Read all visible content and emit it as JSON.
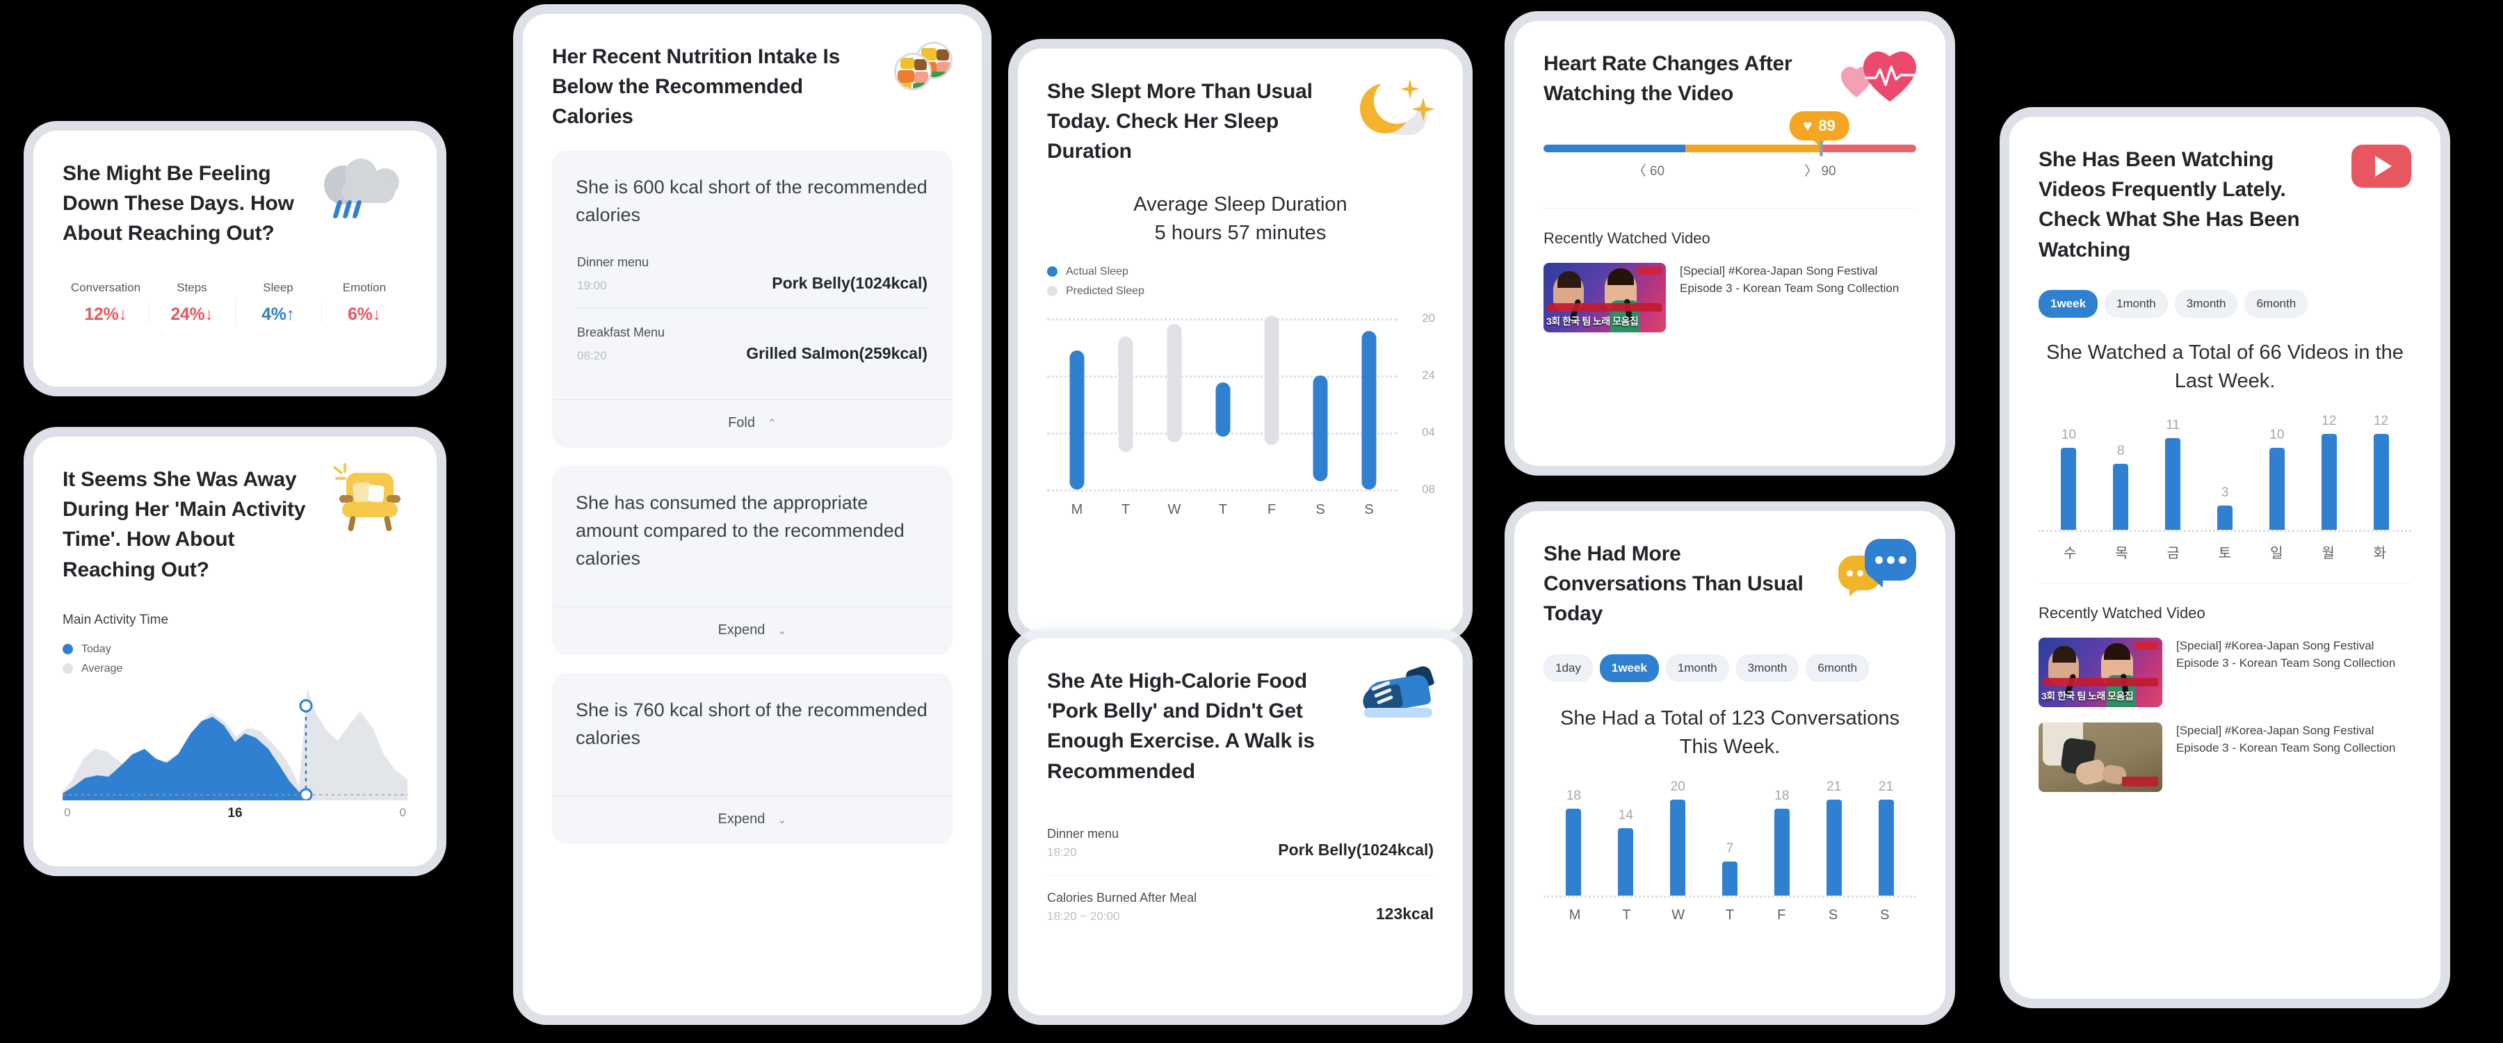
{
  "colors": {
    "blue": "#2f80d0",
    "grey": "#dfe2e7",
    "red": "#e8575f",
    "amber": "#f4a623"
  },
  "mood_card": {
    "headline": "She Might Be Feeling Down These Days. How About Reaching Out?",
    "icon": "rain-cloud-icon",
    "metrics": [
      {
        "label": "Conversation",
        "value": "12%",
        "arrow": "↓",
        "direction": "down"
      },
      {
        "label": "Steps",
        "value": "24%",
        "arrow": "↓",
        "direction": "down"
      },
      {
        "label": "Sleep",
        "value": "4%",
        "arrow": "↑",
        "direction": "up"
      },
      {
        "label": "Emotion",
        "value": "6%",
        "arrow": "↓",
        "direction": "down"
      }
    ]
  },
  "activity_card": {
    "headline": "It Seems She Was Away During Her 'Main Activity Time'. How About Reaching Out?",
    "icon": "armchair-icon",
    "chart_label": "Main Activity Time",
    "legend": [
      {
        "label": "Today",
        "color": "#2f80d0"
      },
      {
        "label": "Average",
        "color": "#dfe2e7"
      }
    ],
    "axis": {
      "left": "0",
      "center": "16",
      "right": "0"
    }
  },
  "nutrition_card": {
    "headline": "Her Recent Nutrition Intake Is Below the Recommended Calories",
    "icon": "food-plates-icon",
    "panels": [
      {
        "text": "She is 600 kcal short of the recommended calories",
        "meals": [
          {
            "label": "Dinner menu",
            "time": "19:00",
            "value": "Pork Belly(1024kcal)"
          },
          {
            "label": "Breakfast Menu",
            "time": "08:20",
            "value": "Grilled Salmon(259kcal)"
          }
        ],
        "foot": "Fold",
        "foot_chevron": "⌃"
      },
      {
        "text": "She has consumed the appropriate amount compared to the recommended calories",
        "meals": [],
        "foot": "Expend",
        "foot_chevron": "⌄"
      },
      {
        "text": "She is 760 kcal short of the recommended calories",
        "meals": [],
        "foot": "Expend",
        "foot_chevron": "⌄"
      }
    ]
  },
  "sleep_card": {
    "headline": "She Slept More Than Usual Today. Check Her Sleep Duration",
    "icon": "moon-stars-icon",
    "center_title": "Average Sleep Duration\n5 hours 57 minutes",
    "legend": [
      {
        "label": "Actual Sleep",
        "color": "#2f80d0"
      },
      {
        "label": "Predicted Sleep",
        "color": "#dfe1e5"
      }
    ],
    "chart_data": {
      "type": "bar",
      "title": "Average Sleep Duration",
      "categories": [
        "M",
        "T",
        "W",
        "T",
        "F",
        "S",
        "S"
      ],
      "ytick_labels": [
        "20",
        "24",
        "04",
        "08"
      ],
      "ylabel": "",
      "xlabel": "",
      "grid": true,
      "note": "Floating bars spanning sleep start to sleep end on a 20:00-08:00 clock axis",
      "series": [
        {
          "name": "Actual Sleep",
          "color": "#2f80d0",
          "bars": [
            {
              "day": "M",
              "start": "22:20",
              "end": "08:00"
            },
            {
              "day": "T",
              "start": null,
              "end": null
            },
            {
              "day": "W",
              "start": null,
              "end": null
            },
            {
              "day": "T",
              "start": "00:30",
              "end": "04:40"
            },
            {
              "day": "F",
              "start": null,
              "end": null
            },
            {
              "day": "S",
              "start": "23:50",
              "end": "07:30"
            },
            {
              "day": "S",
              "start": "22:50",
              "end": "08:00"
            }
          ]
        },
        {
          "name": "Predicted Sleep",
          "color": "#dfe1e5",
          "bars": [
            {
              "day": "M",
              "start": null,
              "end": null
            },
            {
              "day": "T",
              "start": "21:50",
              "end": "06:50"
            },
            {
              "day": "W",
              "start": "21:10",
              "end": "05:40"
            },
            {
              "day": "T",
              "start": null,
              "end": null
            },
            {
              "day": "F",
              "start": "20:40",
              "end": "06:20"
            },
            {
              "day": "S",
              "start": null,
              "end": null
            },
            {
              "day": "S",
              "start": null,
              "end": null
            }
          ]
        }
      ]
    }
  },
  "walk_card": {
    "headline": "She Ate High-Calorie Food 'Pork Belly' and Didn't Get Enough Exercise. A Walk is Recommended",
    "icon": "sneaker-icon",
    "rows": [
      {
        "label": "Dinner menu",
        "time": "18:20",
        "value": "Pork Belly(1024kcal)"
      },
      {
        "label": "Calories Burned After Meal",
        "time": "18:20 ~ 20:00",
        "value": "123kcal"
      }
    ]
  },
  "heart_card": {
    "headline": "Heart Rate Changes After Watching the Video",
    "icon": "heartbeat-icon",
    "bubble": {
      "heart": "♥",
      "value": "89"
    },
    "gauge": {
      "low_label": "〈 60",
      "high_label": "〉 90",
      "low_color": "#2f80d0",
      "mid_color": "#f4a623",
      "high_color": "#e8636d",
      "needle_percent": 74
    },
    "section_title": "Recently Watched Video",
    "videos": [
      {
        "title": "[Special] #Korea-Japan Song Festival Episode 3 - Korean Team Song Collection",
        "thumb_caption": "3회 한국 팀 노래 모음집",
        "thumb_type": "singers"
      }
    ]
  },
  "convo_card": {
    "headline": "She Had More Conversations Than Usual Today",
    "icon": "speech-bubbles-icon",
    "chips": [
      {
        "label": "1day",
        "active": false
      },
      {
        "label": "1week",
        "active": true
      },
      {
        "label": "1month",
        "active": false
      },
      {
        "label": "3month",
        "active": false
      },
      {
        "label": "6month",
        "active": false
      }
    ],
    "chart_data": {
      "type": "bar",
      "title": "She Had a Total of 123 Conversations This Week.",
      "categories": [
        "M",
        "T",
        "W",
        "T",
        "F",
        "S",
        "S"
      ],
      "values": [
        18,
        14,
        20,
        7,
        18,
        21,
        21
      ],
      "ylim": [
        0,
        24
      ],
      "xlabel": "",
      "ylabel": "",
      "grid": false,
      "color": "#2f80d0",
      "total": 123
    }
  },
  "youtube_card": {
    "headline": "She Has Been Watching Videos Frequently Lately. Check What She Has Been Watching",
    "icon": "youtube-play-icon",
    "chips": [
      {
        "label": "1week",
        "active": true
      },
      {
        "label": "1month",
        "active": false
      },
      {
        "label": "3month",
        "active": false
      },
      {
        "label": "6month",
        "active": false
      }
    ],
    "chart_data": {
      "type": "bar",
      "title": "She Watched a Total of 66 Videos in the Last Week.",
      "categories": [
        "수",
        "목",
        "금",
        "토",
        "일",
        "월",
        "화"
      ],
      "values": [
        10,
        8,
        11,
        3,
        10,
        12,
        12
      ],
      "ylim": [
        0,
        14
      ],
      "xlabel": "",
      "ylabel": "",
      "grid": false,
      "color": "#2f80d0",
      "total": 66
    },
    "section_title": "Recently Watched Video",
    "videos": [
      {
        "title": "[Special] #Korea-Japan Song Festival Episode 3 - Korean Team Song Collection",
        "thumb_caption": "3회 한국 팀 노래 모음집",
        "thumb_type": "singers"
      },
      {
        "title": "[Special] #Korea-Japan Song Festival Episode 3 - Korean Team Song Collection",
        "thumb_caption": "",
        "thumb_type": "sand"
      }
    ]
  }
}
